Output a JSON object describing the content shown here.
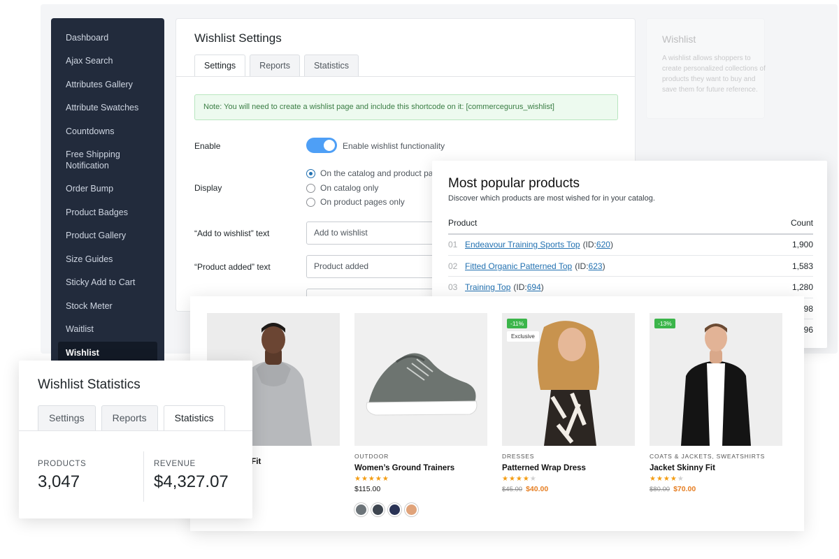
{
  "sidebar": {
    "items": [
      {
        "label": "Dashboard"
      },
      {
        "label": "Ajax Search"
      },
      {
        "label": "Attributes Gallery"
      },
      {
        "label": "Attribute Swatches"
      },
      {
        "label": "Countdowns"
      },
      {
        "label": "Free Shipping Notification"
      },
      {
        "label": "Order Bump"
      },
      {
        "label": "Product Badges"
      },
      {
        "label": "Product Gallery"
      },
      {
        "label": "Size Guides"
      },
      {
        "label": "Sticky Add to Cart"
      },
      {
        "label": "Stock Meter"
      },
      {
        "label": "Waitlist"
      },
      {
        "label": "Wishlist"
      }
    ]
  },
  "settings": {
    "title": "Wishlist Settings",
    "tabs": [
      "Settings",
      "Reports",
      "Statistics"
    ],
    "notice": "Note: You will need to create a wishlist page and include this shortcode on it: [commercegurus_wishlist]",
    "enable_label": "Enable",
    "enable_text": "Enable wishlist functionality",
    "display_label": "Display",
    "display_options": [
      "On the catalog and product pa",
      "On catalog only",
      "On product pages only"
    ],
    "add_text_label": "“Add to wishlist” text",
    "add_text_value": "Add to wishlist",
    "added_text_label": "“Product added” text",
    "added_text_value": "Product added"
  },
  "side_card": {
    "title": "Wishlist",
    "text": "A wishlist allows shoppers to create personalized collections of products they want to buy and save them for future reference."
  },
  "popular": {
    "title": "Most popular products",
    "subtitle": "Discover which products are most wished for in your catalog.",
    "col_product": "Product",
    "col_count": "Count",
    "rows": [
      {
        "num": "01",
        "name": "Endeavour Training Sports Top",
        "id_prefix": "(ID: ",
        "id": "620",
        "id_suffix": ")",
        "count": "1,900"
      },
      {
        "num": "02",
        "name": "Fitted Organic Patterned Top",
        "id_prefix": "(ID: ",
        "id": "623",
        "id_suffix": ")",
        "count": "1,583"
      },
      {
        "num": "03",
        "name": "Training Top",
        "id_prefix": "(ID: ",
        "id": "694",
        "id_suffix": ")",
        "count": "1,280"
      },
      {
        "num": "",
        "name": "",
        "id_prefix": "",
        "id": "",
        "id_suffix": "",
        "count": "98"
      },
      {
        "num": "",
        "name": "",
        "id_prefix": "",
        "id": "",
        "id_suffix": "",
        "count": "96"
      }
    ]
  },
  "shop": {
    "products": [
      {
        "category": "",
        "name": "lar Fit",
        "price": "",
        "icon": "hoodie-model-photo"
      },
      {
        "category": "OUTDOOR",
        "name": "Women’s Ground Trainers",
        "stars": "★★★★★",
        "empty_stars": "",
        "price": "$115.00",
        "icon": "sneaker-photo"
      },
      {
        "category": "DRESSES",
        "name": "Patterned Wrap Dress",
        "badge": "-11%",
        "badge2": "Exclusive",
        "stars": "★★★★",
        "empty_stars": "★",
        "old_price": "$45.00",
        "sale_price": "$40.00",
        "icon": "dress-model-photo"
      },
      {
        "category": "COATS & JACKETS, SWEATSHIRTS",
        "name": "Jacket Skinny Fit",
        "badge": "-13%",
        "stars": "★★★★",
        "empty_stars": "★",
        "old_price": "$80.00",
        "sale_price": "$70.00",
        "icon": "jacket-model-photo"
      }
    ],
    "swatch_colors": [
      "#6c7479",
      "#3e4650",
      "#2a3356",
      "#e0a37a"
    ]
  },
  "stats": {
    "title": "Wishlist Statistics",
    "tabs": [
      "Settings",
      "Reports",
      "Statistics"
    ],
    "products_label": "PRODUCTS",
    "products_value": "3,047",
    "revenue_label": "REVENUE",
    "revenue_value": "$4,327.07"
  },
  "colors": {
    "sidebar_bg": "#222b3c",
    "toggle_on": "#4e9ff6",
    "link": "#2271b1",
    "sale_badge": "#3bb54a",
    "sale_price": "#e67e22"
  }
}
